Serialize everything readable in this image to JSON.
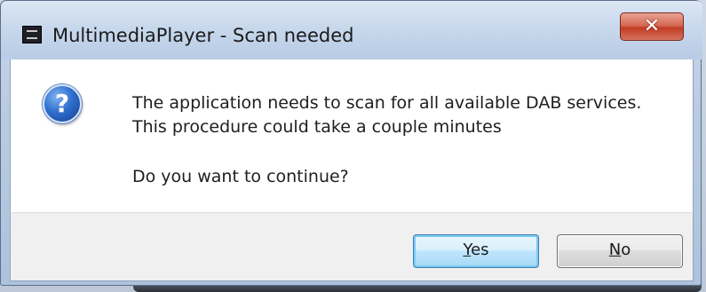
{
  "window": {
    "title": "MultimediaPlayer - Scan needed",
    "app_icon": "app-icon",
    "close_glyph": "✕"
  },
  "message": {
    "icon": "question-icon",
    "icon_glyph": "?",
    "line1": "The application needs to scan for all available DAB services.",
    "line2": "This procedure could take a couple minutes",
    "question": "Do you want to continue?"
  },
  "buttons": {
    "yes": {
      "mnemonic": "Y",
      "rest": "es",
      "default": true
    },
    "no": {
      "mnemonic": "N",
      "rest": "o",
      "default": false
    }
  },
  "colors": {
    "accent": "#3c7fb1",
    "close": "#c43c23"
  }
}
